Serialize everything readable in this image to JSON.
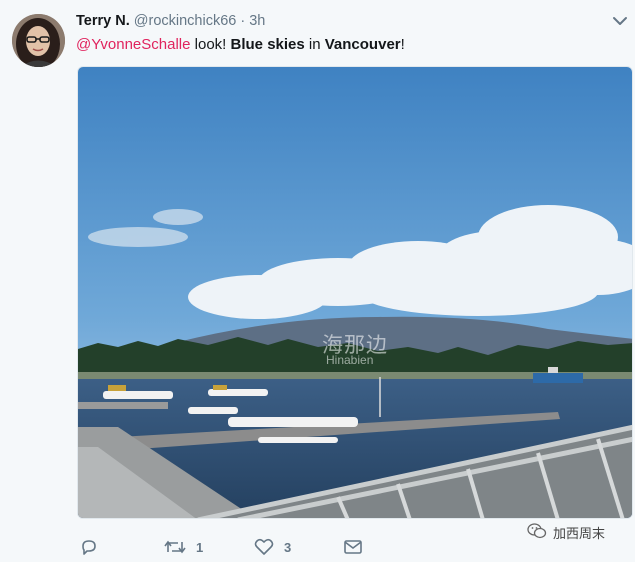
{
  "tweet": {
    "author_name": "Terry N.",
    "handle": "@rockinchick66",
    "separator": "·",
    "time": "3h",
    "text_mention": "@YvonneSchalle",
    "text_1": " look! ",
    "text_bold_1": "Blue skies",
    "text_2": " in ",
    "text_bold_2": "Vancouver",
    "text_3": "!"
  },
  "media": {
    "watermark_text": "海那边",
    "watermark_sub": "Hinabien"
  },
  "actions": {
    "reply_count": "",
    "retweet_count": "1",
    "like_count": "3"
  },
  "overlay": {
    "wechat_label": "加西周末"
  },
  "colors": {
    "mention": "#e0245e",
    "meta_gray": "#657786",
    "background": "#f5f8fa"
  }
}
